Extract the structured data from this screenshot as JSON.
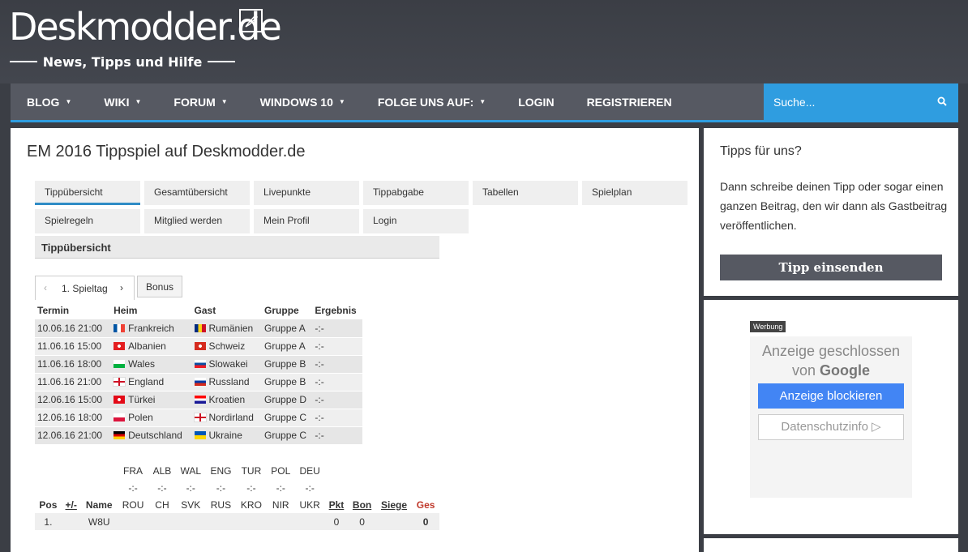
{
  "logo": {
    "text": "Deskmodder.de",
    "subtitle": "News, Tipps und Hilfe"
  },
  "nav": {
    "items": [
      {
        "label": "BLOG",
        "caret": "▼"
      },
      {
        "label": "WIKI",
        "caret": "▼"
      },
      {
        "label": "FORUM",
        "caret": "▼"
      },
      {
        "label": "WINDOWS 10",
        "caret": "▼"
      },
      {
        "label": "FOLGE UNS AUF:",
        "caret": "▼"
      },
      {
        "label": "LOGIN",
        "caret": ""
      },
      {
        "label": "REGISTRIEREN",
        "caret": ""
      }
    ],
    "search_placeholder": "Suche..."
  },
  "colors": {
    "accent": "#2f9de0",
    "nav_bg": "#565962",
    "page_bg": "#3b3e45"
  },
  "main": {
    "title": "EM 2016 Tippspiel auf Deskmodder.de",
    "tabs": [
      "Tippübersicht",
      "Gesamtübersicht",
      "Livepunkte",
      "Tippabgabe",
      "Tabellen",
      "Spielplan",
      "Spielregeln",
      "Mitglied werden",
      "Mein Profil",
      "Login"
    ],
    "active_tab": "Tippübersicht",
    "section_heading": "Tippübersicht",
    "spieltag_tabs": {
      "prev": "‹",
      "label": "1. Spieltag",
      "next": "›",
      "bonus": "Bonus"
    },
    "games_headers": [
      "Termin",
      "Heim",
      "Gast",
      "Gruppe",
      "Ergebnis"
    ],
    "games": [
      {
        "termin": "10.06.16 21:00",
        "heim": "Frankreich",
        "heim_flag": "fr",
        "gast": "Rumänien",
        "gast_flag": "ro",
        "gruppe": "Gruppe A",
        "ergebnis": "-:-"
      },
      {
        "termin": "11.06.16 15:00",
        "heim": "Albanien",
        "heim_flag": "al",
        "gast": "Schweiz",
        "gast_flag": "ch",
        "gruppe": "Gruppe A",
        "ergebnis": "-:-"
      },
      {
        "termin": "11.06.16 18:00",
        "heim": "Wales",
        "heim_flag": "wal",
        "gast": "Slowakei",
        "gast_flag": "sk",
        "gruppe": "Gruppe B",
        "ergebnis": "-:-"
      },
      {
        "termin": "11.06.16 21:00",
        "heim": "England",
        "heim_flag": "eng",
        "gast": "Russland",
        "gast_flag": "ru",
        "gruppe": "Gruppe B",
        "ergebnis": "-:-"
      },
      {
        "termin": "12.06.16 15:00",
        "heim": "Türkei",
        "heim_flag": "tr",
        "gast": "Kroatien",
        "gast_flag": "hr",
        "gruppe": "Gruppe D",
        "ergebnis": "-:-"
      },
      {
        "termin": "12.06.16 18:00",
        "heim": "Polen",
        "heim_flag": "pl",
        "gast": "Nordirland",
        "gast_flag": "nir",
        "gruppe": "Gruppe C",
        "ergebnis": "-:-"
      },
      {
        "termin": "12.06.16 21:00",
        "heim": "Deutschland",
        "heim_flag": "de",
        "gast": "Ukraine",
        "gast_flag": "ua",
        "gruppe": "Gruppe C",
        "ergebnis": "-:-"
      }
    ],
    "leaderboard": {
      "home_codes": [
        "FRA",
        "ALB",
        "WAL",
        "ENG",
        "TUR",
        "POL",
        "DEU"
      ],
      "scores": [
        "-:-",
        "-:-",
        "-:-",
        "-:-",
        "-:-",
        "-:-",
        "-:-"
      ],
      "away_codes": [
        "ROU",
        "CH",
        "SVK",
        "RUS",
        "KRO",
        "NIR",
        "UKR"
      ],
      "headers": {
        "pos": "Pos",
        "plusminus": "+/-",
        "name": "Name",
        "pkt": "Pkt",
        "bon": "Bon",
        "siege": "Siege",
        "ges": "Ges"
      },
      "rows": [
        {
          "pos": "1.",
          "plusminus": "",
          "name": "W8U",
          "pkt": "0",
          "bon": "0",
          "siege": "",
          "ges": "0"
        }
      ]
    }
  },
  "sidebar": {
    "tipps": {
      "title": "Tipps für uns?",
      "text": "Dann schreibe deinen Tipp oder sogar einen ganzen Beitrag, den wir dann als Gastbeitrag veröffentlichen.",
      "button": "Tipp einsenden"
    },
    "ad": {
      "badge": "Werbung",
      "closed_line1": "Anzeige geschlossen",
      "closed_line2_prefix": "von",
      "closed_line2_brand": "Google",
      "block_button": "Anzeige blockieren",
      "info_button": "Datenschutzinfo ▷"
    }
  }
}
